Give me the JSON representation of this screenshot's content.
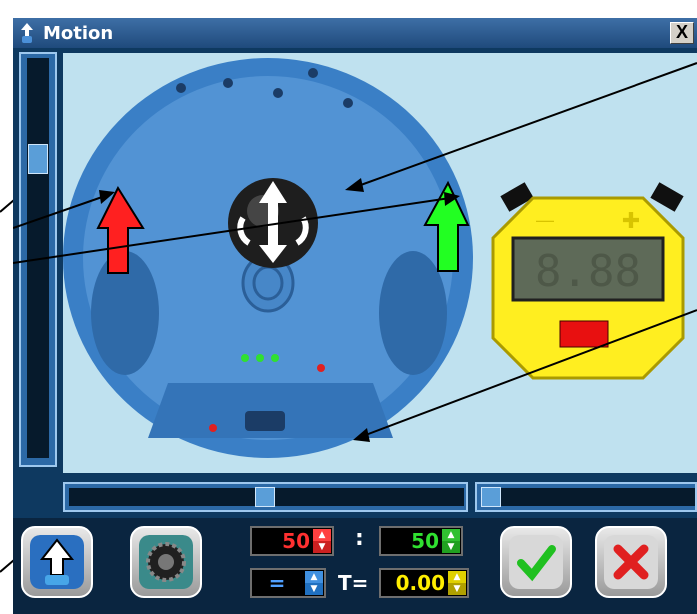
{
  "window": {
    "title": "Motion",
    "close_label": "X"
  },
  "controls": {
    "left_speed": "50",
    "separator": ":",
    "right_speed": "50",
    "operator": "=",
    "time_label": "T=",
    "time_value": "0.00"
  },
  "stopwatch": {
    "display": "8.88",
    "minus_label": "—",
    "plus_label": "✚"
  },
  "colors": {
    "left_speed": "#ff3030",
    "right_speed": "#30e030",
    "time": "#ffee00",
    "operator": "#50a0ff",
    "stopwatch": "#ffee20"
  },
  "icons": [
    "motion-title-icon",
    "close-icon",
    "red-up-arrow-icon",
    "green-up-arrow-icon",
    "direction-ball-icon",
    "robot-motion-icon",
    "gear-icon",
    "checkmark-icon",
    "cancel-x-icon"
  ]
}
